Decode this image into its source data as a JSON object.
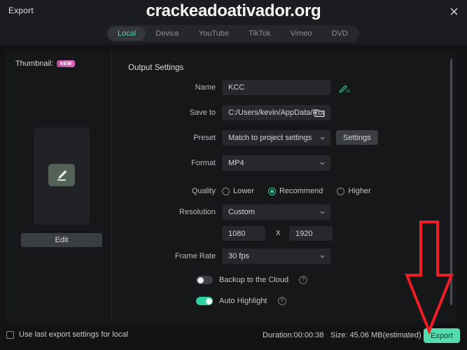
{
  "window": {
    "title": "Export",
    "close_icon": "close-icon",
    "watermark": "crackeadoativador.org"
  },
  "tabs": [
    {
      "label": "Local",
      "active": true
    },
    {
      "label": "Device",
      "active": false
    },
    {
      "label": "YouTube",
      "active": false
    },
    {
      "label": "TikTok",
      "active": false
    },
    {
      "label": "Vimeo",
      "active": false
    },
    {
      "label": "DVD",
      "active": false
    }
  ],
  "thumbnail": {
    "label": "Thumbnail:",
    "badge": "NEW",
    "edit_icon": "pencil-icon",
    "edit_button": "Edit"
  },
  "output_settings": {
    "section_title": "Output Settings",
    "name": {
      "label": "Name",
      "value": "KCC",
      "ai_icon": "ai-pen-icon"
    },
    "save_to": {
      "label": "Save to",
      "value": "C:/Users/kevin/AppData/Roan",
      "folder_icon": "folder-icon"
    },
    "preset": {
      "label": "Preset",
      "value": "Match to project settings",
      "settings_button": "Settings"
    },
    "format": {
      "label": "Format",
      "value": "MP4"
    },
    "quality": {
      "label": "Quality",
      "options": [
        {
          "label": "Lower",
          "selected": false
        },
        {
          "label": "Recommend",
          "selected": true
        },
        {
          "label": "Higher",
          "selected": false
        }
      ]
    },
    "resolution": {
      "label": "Resolution",
      "value": "Custom",
      "width": "1080",
      "separator": "X",
      "height": "1920"
    },
    "frame_rate": {
      "label": "Frame Rate",
      "value": "30 fps"
    },
    "backup_cloud": {
      "label": "Backup to the Cloud",
      "enabled": false,
      "help_icon": "help-icon",
      "help_glyph": "?"
    },
    "auto_highlight": {
      "label": "Auto Highlight",
      "enabled": true,
      "help_icon": "help-icon",
      "help_glyph": "?"
    }
  },
  "footer": {
    "use_last_settings": "Use last export settings for local",
    "duration": "Duration:00:00:38",
    "size": "Size: 45.06 MB(estimated)",
    "export_button": "Export"
  },
  "colors": {
    "accent_green": "#2fd39f",
    "export_green": "#54dcb0",
    "badge_pink": "#e262c0",
    "annotation_red": "#ee1c25",
    "panel_bg": "#161719",
    "field_bg": "#26282c"
  }
}
